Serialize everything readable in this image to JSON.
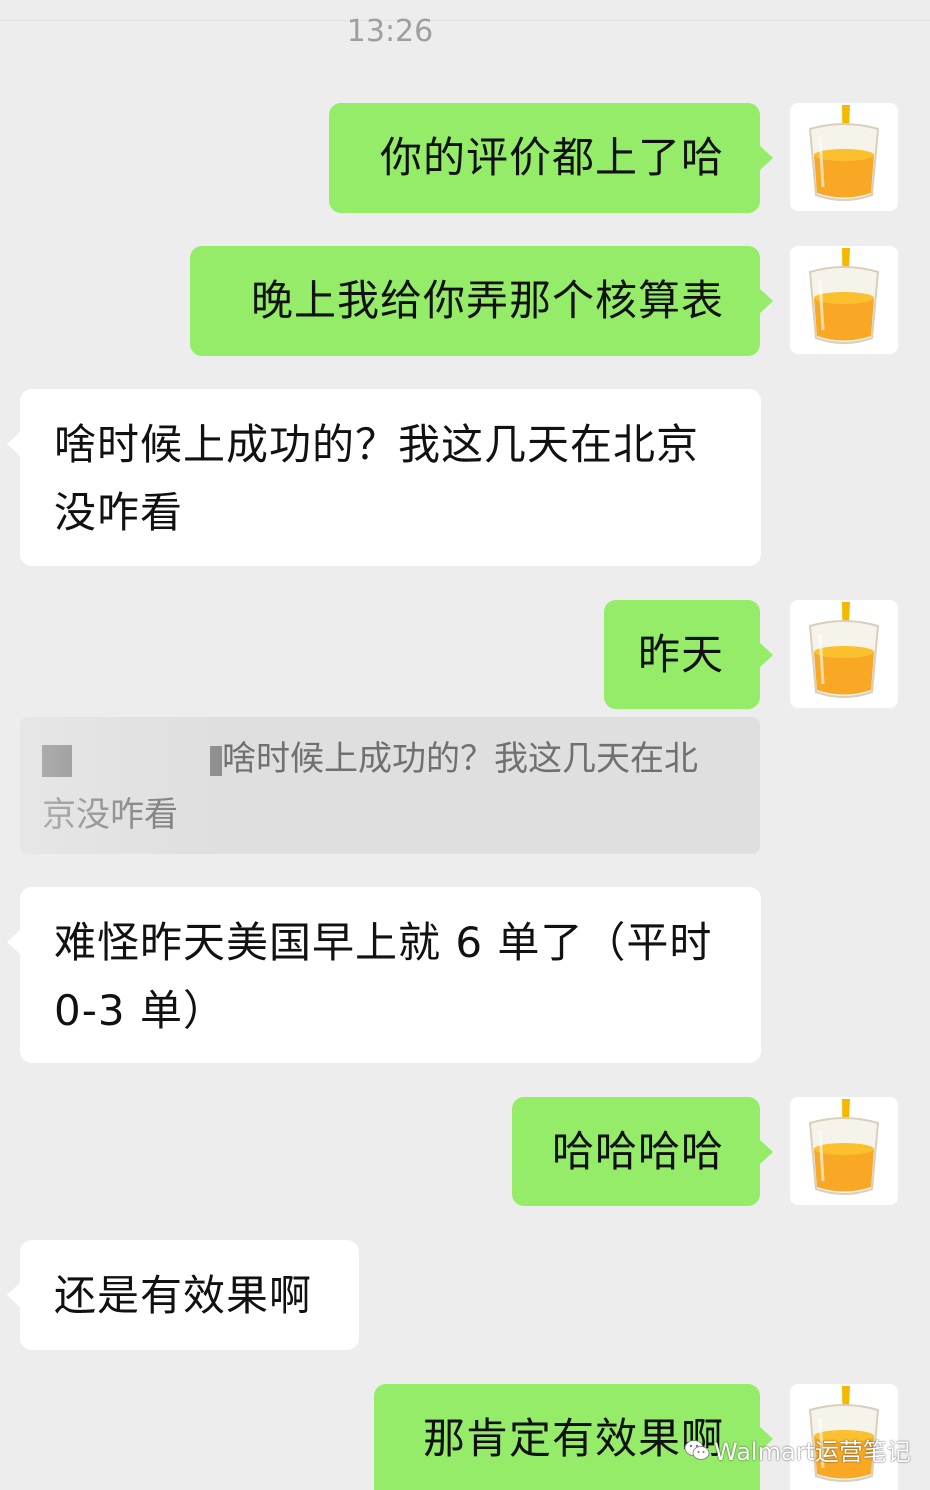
{
  "chat": {
    "timestamp": "13:26",
    "messages": [
      {
        "side": "out",
        "text": "你的评价都上了哈"
      },
      {
        "side": "out",
        "text": "晚上我给你弄那个核算表"
      },
      {
        "side": "in",
        "text": "啥时候上成功的？我这几天在北京没咋看"
      },
      {
        "side": "out",
        "text": "昨天"
      },
      {
        "side": "quote",
        "text": "啥时候上成功的？我这几天在北京没咋看"
      },
      {
        "side": "in",
        "text": "难怪昨天美国早上就 6 单了（平时 0-3 单）"
      },
      {
        "side": "out",
        "text": "哈哈哈哈"
      },
      {
        "side": "in",
        "text": "还是有效果啊"
      },
      {
        "side": "out",
        "text": "那肯定有效果啊"
      }
    ]
  },
  "avatar": {
    "icon": "orange-juice-glass-icon",
    "juice_color": "#f9a825",
    "straw_color": "#f5b700"
  },
  "colors": {
    "background": "#ededed",
    "outgoing": "#95ec69",
    "incoming": "#ffffff",
    "quote": "#dfdfdf"
  },
  "watermark": {
    "text": "Walmart运营笔记",
    "icon": "wechat-icon"
  }
}
